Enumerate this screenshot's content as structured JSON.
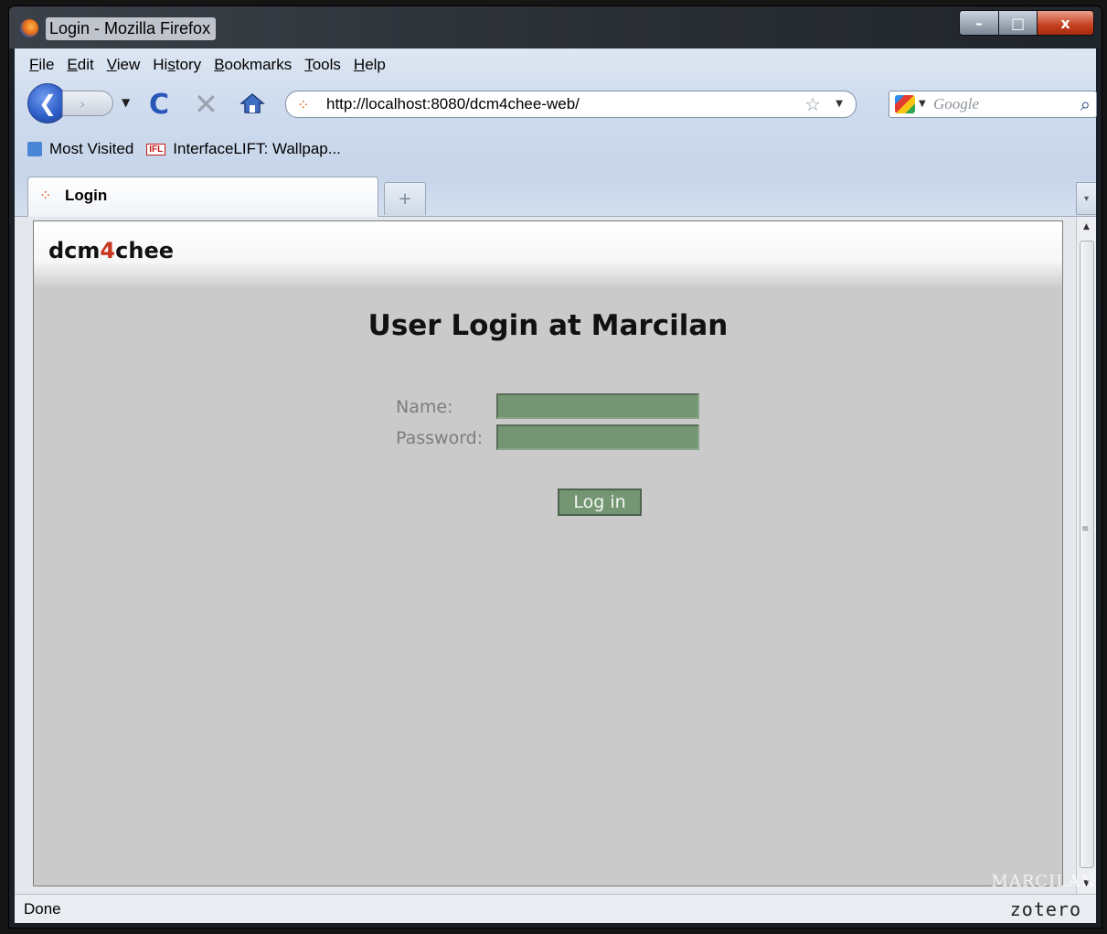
{
  "window": {
    "title": "Login - Mozilla Firefox",
    "buttons": {
      "minimize": "–",
      "maximize": "□",
      "close": "x"
    }
  },
  "menubar": {
    "items": [
      {
        "mnemonic": "F",
        "rest": "ile"
      },
      {
        "mnemonic": "E",
        "rest": "dit"
      },
      {
        "mnemonic": "V",
        "rest": "iew"
      },
      {
        "pre": "Hi",
        "mnemonic": "s",
        "rest": "tory"
      },
      {
        "mnemonic": "B",
        "rest": "ookmarks"
      },
      {
        "mnemonic": "T",
        "rest": "ools"
      },
      {
        "mnemonic": "H",
        "rest": "elp"
      }
    ]
  },
  "navbar": {
    "back_glyph": "❮",
    "forward_glyph": "›",
    "reload_glyph": "C",
    "stop_glyph": "✕",
    "url": "http://localhost:8080/dcm4chee-web/",
    "star_glyph": "☆",
    "search_placeholder": "Google",
    "search_glass_glyph": "⌕"
  },
  "bookmarks": {
    "items": [
      "Most Visited",
      "InterfaceLIFT: Wallpap..."
    ],
    "ifl_badge": "IFL"
  },
  "tabs": {
    "active_label": "Login",
    "new_tab_glyph": "+"
  },
  "page": {
    "logo_prefix": "dcm",
    "logo_four": "4",
    "logo_suffix": "chee",
    "title": "User Login at Marcilan",
    "form": {
      "name_label": "Name:",
      "password_label": "Password:",
      "name_value": "",
      "password_value": "",
      "submit_label": "Log in"
    }
  },
  "statusbar": {
    "text": "Done",
    "zotero": "zotero"
  },
  "watermark": "MARCILAN",
  "colors": {
    "page_bg": "#cacaca",
    "input_bg": "#749672",
    "logo_accent": "#c8341c"
  }
}
